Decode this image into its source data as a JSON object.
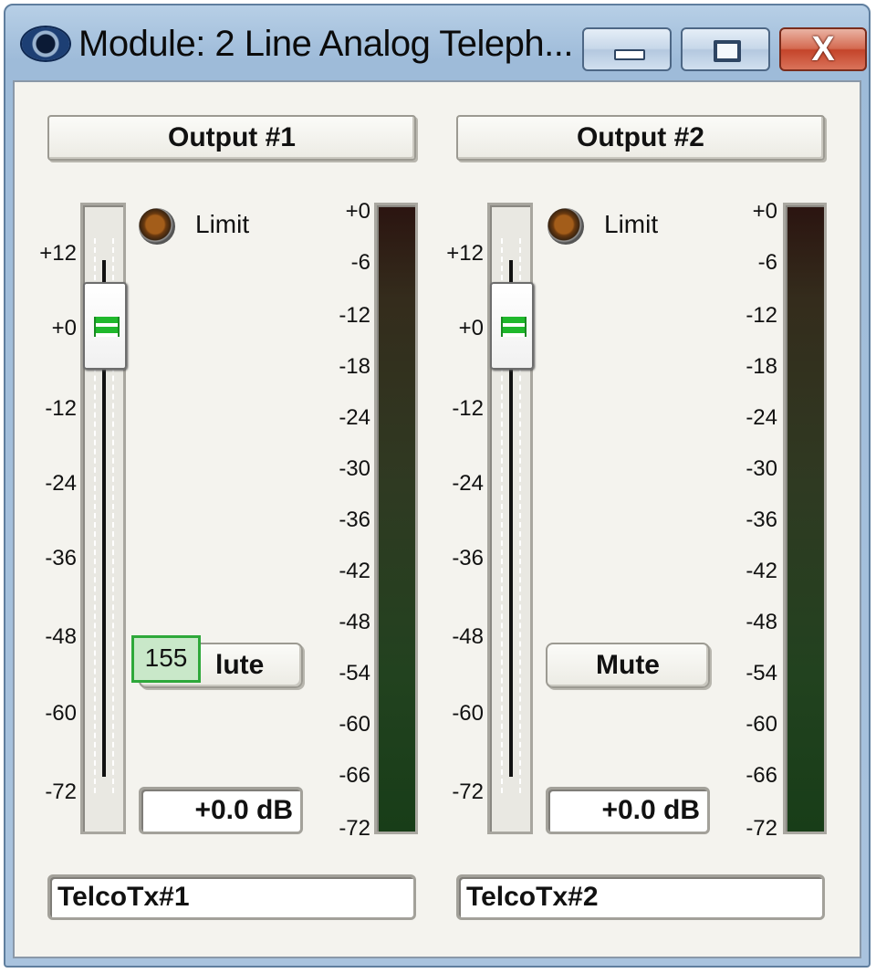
{
  "window": {
    "title": "Module: 2 Line Analog Teleph...",
    "icon": "eye-icon",
    "controls": {
      "minimize": "minimize-icon",
      "maximize": "maximize-icon",
      "close": "close-icon",
      "close_glyph": "X"
    }
  },
  "fader_scale": [
    "+12",
    "+0",
    "-12",
    "-24",
    "-36",
    "-48",
    "-60",
    "-72"
  ],
  "meter_scale": [
    "+0",
    "-6",
    "-12",
    "-18",
    "-24",
    "-30",
    "-36",
    "-42",
    "-48",
    "-54",
    "-60",
    "-66",
    "-72"
  ],
  "channels": [
    {
      "header": "Output #1",
      "limit_label": "Limit",
      "mute_label": "Mute",
      "mute_visible_text": "lute",
      "gain_value": "+0.0 dB",
      "gain_db": 0.0,
      "name": "TelcoTx#1",
      "tooltip": "155"
    },
    {
      "header": "Output #2",
      "limit_label": "Limit",
      "mute_label": "Mute",
      "gain_value": "+0.0 dB",
      "gain_db": 0.0,
      "name": "TelcoTx#2"
    }
  ],
  "colors": {
    "led_off": "#6b3a0f",
    "fader_grip": "#1fb82c",
    "meter_top": "#2b1410",
    "meter_bottom": "#183d18",
    "tooltip_border": "#2ea83a"
  }
}
